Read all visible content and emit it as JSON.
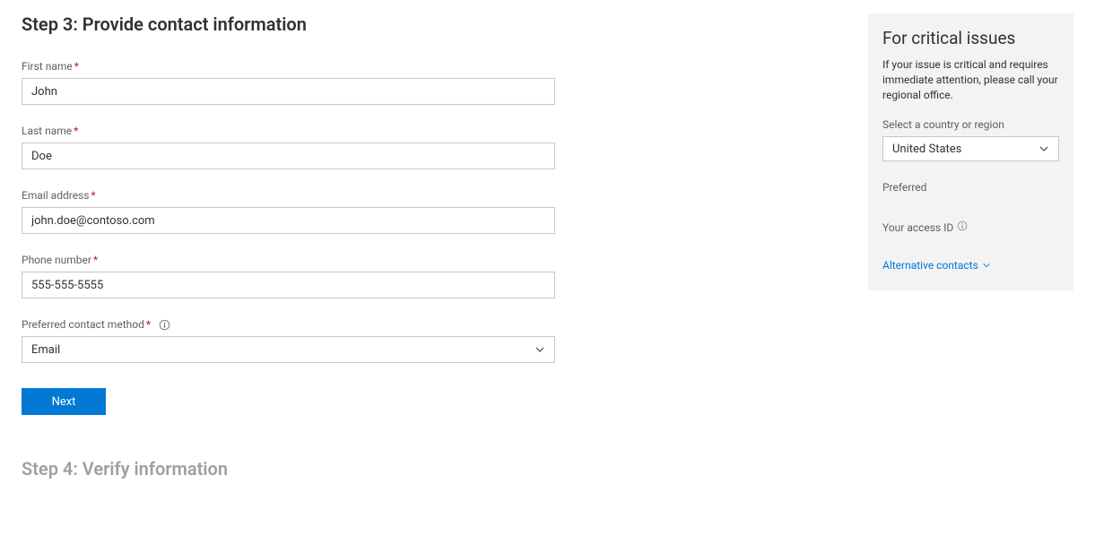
{
  "step3": {
    "heading": "Step 3: Provide contact information",
    "first_name_label": "First name",
    "first_name_value": "John",
    "last_name_label": "Last name",
    "last_name_value": "Doe",
    "email_label": "Email address",
    "email_value": "john.doe@contoso.com",
    "phone_label": "Phone number",
    "phone_value": "555-555-5555",
    "contact_method_label": "Preferred contact method",
    "contact_method_value": "Email",
    "next_button": "Next"
  },
  "step4": {
    "heading": "Step 4: Verify information"
  },
  "sidebar": {
    "title": "For critical issues",
    "description": "If your issue is critical and requires immediate attention, please call your regional office.",
    "country_label": "Select a country or region",
    "country_value": "United States",
    "preferred_label": "Preferred",
    "access_id_label": "Your access ID",
    "alt_contacts_label": "Alternative contacts"
  }
}
